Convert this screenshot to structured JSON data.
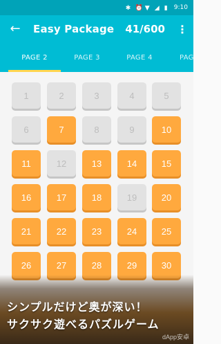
{
  "status": {
    "time": "9:10"
  },
  "appbar": {
    "title": "Easy Package",
    "counter": "41/600"
  },
  "tabs": [
    {
      "label": "PAGE 2",
      "active": true
    },
    {
      "label": "PAGE 3",
      "active": false
    },
    {
      "label": "PAGE 4",
      "active": false
    },
    {
      "label": "PAGE",
      "active": false
    }
  ],
  "levels": [
    {
      "n": "1",
      "state": "locked"
    },
    {
      "n": "2",
      "state": "locked"
    },
    {
      "n": "3",
      "state": "locked"
    },
    {
      "n": "4",
      "state": "locked"
    },
    {
      "n": "5",
      "state": "locked"
    },
    {
      "n": "6",
      "state": "locked"
    },
    {
      "n": "7",
      "state": "done"
    },
    {
      "n": "8",
      "state": "locked"
    },
    {
      "n": "9",
      "state": "locked"
    },
    {
      "n": "10",
      "state": "done"
    },
    {
      "n": "11",
      "state": "done"
    },
    {
      "n": "12",
      "state": "locked"
    },
    {
      "n": "13",
      "state": "done"
    },
    {
      "n": "14",
      "state": "done"
    },
    {
      "n": "15",
      "state": "done"
    },
    {
      "n": "16",
      "state": "done"
    },
    {
      "n": "17",
      "state": "done"
    },
    {
      "n": "18",
      "state": "done"
    },
    {
      "n": "19",
      "state": "locked"
    },
    {
      "n": "20",
      "state": "done"
    },
    {
      "n": "21",
      "state": "done"
    },
    {
      "n": "22",
      "state": "done"
    },
    {
      "n": "23",
      "state": "done"
    },
    {
      "n": "24",
      "state": "done"
    },
    {
      "n": "25",
      "state": "done"
    },
    {
      "n": "26",
      "state": "done"
    },
    {
      "n": "27",
      "state": "done"
    },
    {
      "n": "28",
      "state": "done"
    },
    {
      "n": "29",
      "state": "done"
    },
    {
      "n": "30",
      "state": "done"
    }
  ],
  "banner": {
    "line1": "シンプルだけど奥が深い！",
    "line2": "サクサク遊べるパズルゲーム"
  },
  "watermark": "dApp安卓"
}
